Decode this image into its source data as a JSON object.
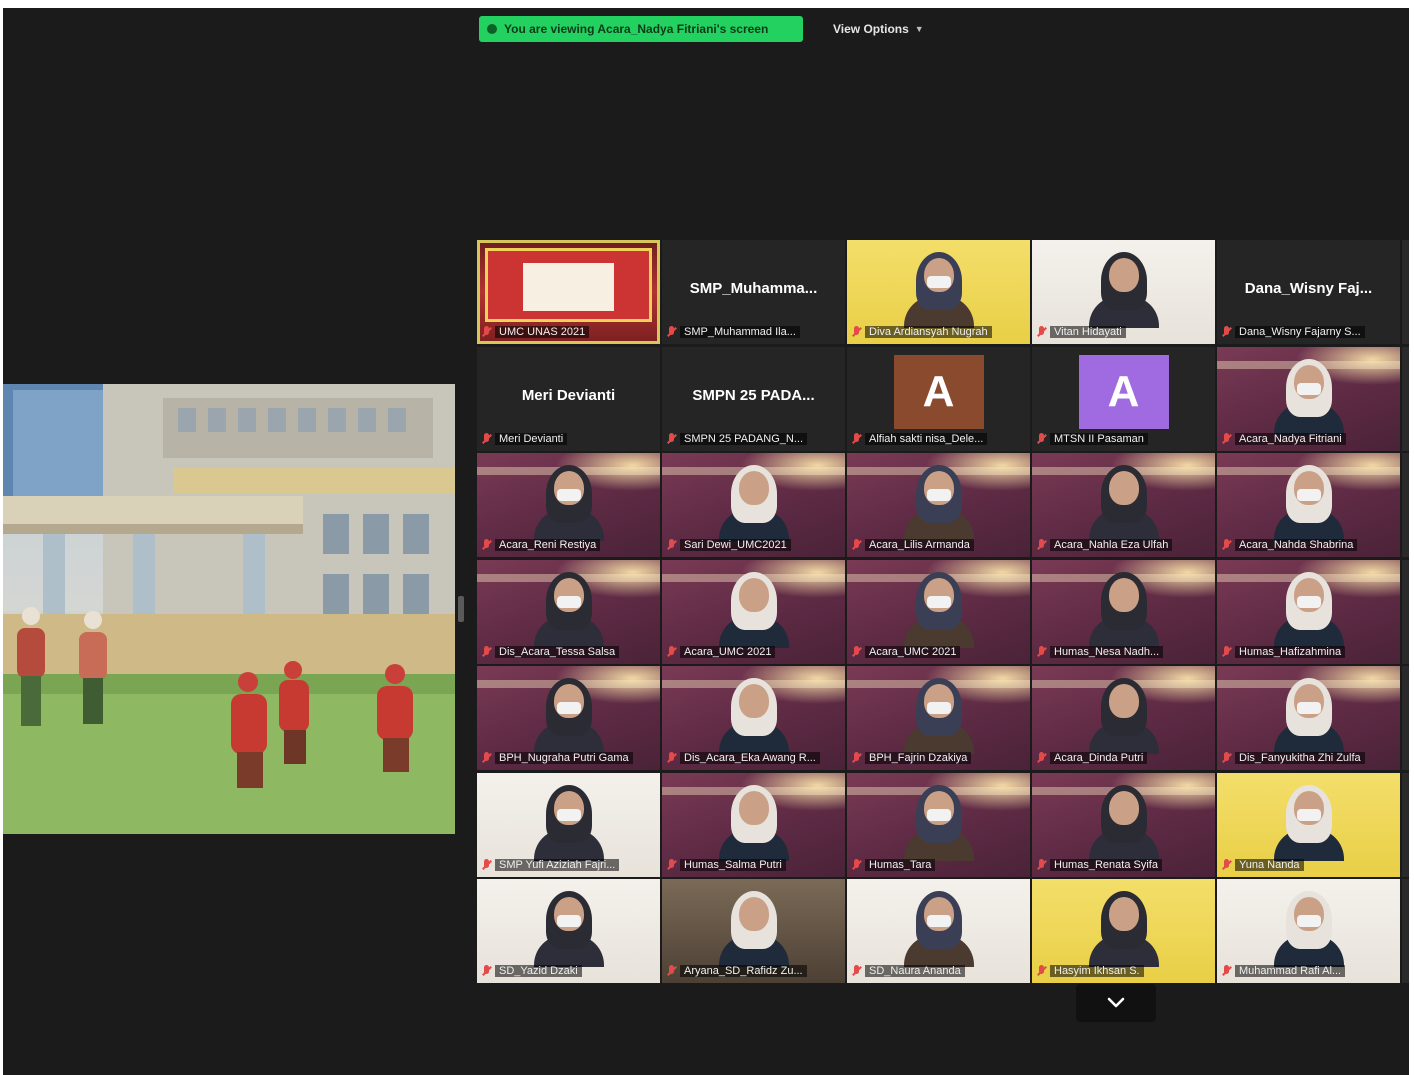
{
  "banner": {
    "sharing_text": "You are viewing Acara_Nadya Fitriani's screen",
    "view_options_label": "View Options"
  },
  "gallery": {
    "tiles": [
      {
        "type": "video",
        "bg": "stage",
        "label": "UMC UNAS 2021",
        "active": true
      },
      {
        "type": "name",
        "center_name": "SMP_Muhamma...",
        "label": "SMP_Muhammad Ila..."
      },
      {
        "type": "video",
        "bg": "yellow",
        "label": "Diva Ardiansyah Nugrah"
      },
      {
        "type": "video",
        "bg": "white",
        "label": "Vitan Hidayati"
      },
      {
        "type": "name",
        "center_name": "Dana_Wisny Faj...",
        "label": "Dana_Wisny Fajarny S..."
      },
      {
        "type": "edge"
      },
      {
        "type": "name",
        "center_name": "Meri Devianti",
        "label": "Meri Devianti"
      },
      {
        "type": "name",
        "center_name": "SMPN 25 PADA...",
        "label": "SMPN 25 PADANG_N..."
      },
      {
        "type": "avatar",
        "letter": "A",
        "avatar_color": "#8a4a2e",
        "label": "Alfiah sakti nisa_Dele..."
      },
      {
        "type": "avatar",
        "letter": "A",
        "avatar_color": "#a06be0",
        "label": "MTSN II Pasaman"
      },
      {
        "type": "video",
        "bg": "maroon",
        "label": "Acara_Nadya Fitriani"
      },
      {
        "type": "edge"
      },
      {
        "type": "video",
        "bg": "maroon",
        "label": "Acara_Reni Restiya"
      },
      {
        "type": "video",
        "bg": "maroon",
        "label": "Sari Dewi_UMC2021"
      },
      {
        "type": "video",
        "bg": "maroon",
        "label": "Acara_Lilis Armanda"
      },
      {
        "type": "video",
        "bg": "maroon",
        "label": "Acara_Nahla Eza Ulfah"
      },
      {
        "type": "video",
        "bg": "maroon",
        "label": "Acara_Nahda Shabrina"
      },
      {
        "type": "edge"
      },
      {
        "type": "video",
        "bg": "maroon",
        "label": "Dis_Acara_Tessa Salsa"
      },
      {
        "type": "video",
        "bg": "maroon",
        "label": "Acara_UMC 2021"
      },
      {
        "type": "video",
        "bg": "maroon",
        "label": "Acara_UMC 2021"
      },
      {
        "type": "video",
        "bg": "maroon",
        "label": "Humas_Nesa Nadh..."
      },
      {
        "type": "video",
        "bg": "maroon",
        "label": "Humas_Hafizahmina"
      },
      {
        "type": "edge"
      },
      {
        "type": "video",
        "bg": "maroon",
        "label": "BPH_Nugraha Putri Gama"
      },
      {
        "type": "video",
        "bg": "maroon",
        "label": "Dis_Acara_Eka Awang R..."
      },
      {
        "type": "video",
        "bg": "maroon",
        "label": "BPH_Fajrin Dzakiya"
      },
      {
        "type": "video",
        "bg": "maroon",
        "label": "Acara_Dinda Putri"
      },
      {
        "type": "video",
        "bg": "maroon",
        "label": "Dis_Fanyukitha Zhi Zulfa"
      },
      {
        "type": "edge"
      },
      {
        "type": "video",
        "bg": "white",
        "label": "SMP Yufi Aziziah Fajri..."
      },
      {
        "type": "video",
        "bg": "maroon",
        "label": "Humas_Salma Putri"
      },
      {
        "type": "video",
        "bg": "maroon",
        "label": "Humas_Tara"
      },
      {
        "type": "video",
        "bg": "maroon",
        "label": "Humas_Renata Syifa"
      },
      {
        "type": "video",
        "bg": "yellow",
        "label": "Yuna Nanda"
      },
      {
        "type": "edge"
      },
      {
        "type": "video",
        "bg": "white",
        "label": "SD_Yazid Dzaki"
      },
      {
        "type": "video",
        "bg": "room",
        "label": "Aryana_SD_Rafidz Zu..."
      },
      {
        "type": "video",
        "bg": "white",
        "label": "SD_Naura Ananda"
      },
      {
        "type": "video",
        "bg": "yellow",
        "label": "Hasyim Ikhsan S."
      },
      {
        "type": "video",
        "bg": "white",
        "label": "Muhammad Rafi Al..."
      },
      {
        "type": "edge"
      }
    ]
  },
  "colors": {
    "window_bg": "#1b1b1b",
    "banner_green": "#23d160",
    "active_speaker": "#d8c65a",
    "muted_red": "#e34a4a"
  }
}
